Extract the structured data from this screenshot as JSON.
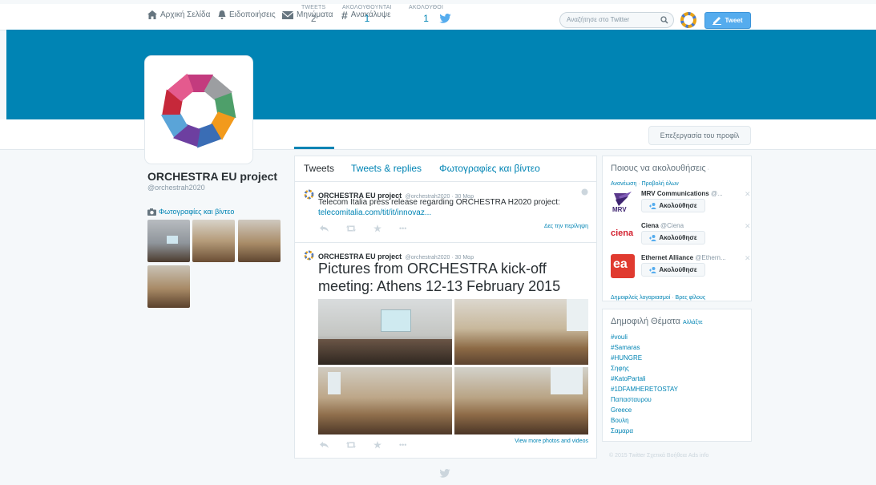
{
  "nav": {
    "home": "Αρχική Σελίδα",
    "notifications": "Ειδοποιήσεις",
    "messages": "Μηνύματα",
    "discover": "Ανακάλυψε",
    "search_placeholder": "Αναζήτησε στο Twitter",
    "tweet_button": "Tweet"
  },
  "profile": {
    "name": "ORCHESTRA EU project",
    "handle": "@orchestrah2020",
    "photos_link": "Φωτογραφίες και βίντεο",
    "edit_button": "Επεξεργασία του προφίλ",
    "stats": [
      {
        "label": "TWEETS",
        "value": "2"
      },
      {
        "label": "ΑΚΟΛΟΥΘΟΥΝΤΑΙ",
        "value": "1"
      },
      {
        "label": "ΑΚΟΛΟΥΘΟΙ",
        "value": "1"
      }
    ]
  },
  "timeline": {
    "tabs": [
      "Tweets",
      "Tweets & replies",
      "Φωτογραφίες και βίντεο"
    ],
    "tweets": [
      {
        "name": "ORCHESTRA EU project",
        "meta": "@orchestrah2020 · 30 Μαρ",
        "text": "Telecom Italia press release regarding ORCHESTRA H2020 project:",
        "link": "telecomitalia.com/tit/it/innovaz...",
        "action_link": "Δες την περίληψη"
      },
      {
        "name": "ORCHESTRA EU project",
        "meta": "@orchestrah2020 · 30 Μαρ",
        "text": "Pictures from ORCHESTRA kick-off meeting: Athens 12-13 February 2015",
        "action_link": "View more photos and videos"
      }
    ]
  },
  "who_to_follow": {
    "title": "Ποιους να ακολουθήσεις",
    "refresh": "Ανανέωση",
    "view_all": "Προβολή όλων",
    "follow_label": "Ακολούθησε",
    "accounts": [
      {
        "name": "MRV Communications",
        "handle": "@...",
        "logo_text": "MRV"
      },
      {
        "name": "Ciena",
        "handle": "@Ciena",
        "logo_text": "ciena"
      },
      {
        "name": "Ethernet Alliance",
        "handle": "@Ethern...",
        "logo_text": "ea"
      }
    ],
    "popular": "Δημοφιλείς λογαριασμοί",
    "find_friends": "Βρες φίλους"
  },
  "trends": {
    "title": "Δημοφιλή Θέματα",
    "change": "Αλλάξτε",
    "items": [
      "#vouli",
      "#Samaras",
      "#HUNGRE",
      "Σηφης",
      "#KatoPartali",
      "#1DFAMHERETOSTAY",
      "Παπασταυρου",
      "Greece",
      "Βουλη",
      "Σαμαρα"
    ]
  },
  "footer": "© 2015 Twitter   Σχετικά   Βοήθεια   Ads info",
  "colors": {
    "accent": "#0084b4",
    "tweet_button": "#55acee",
    "banner": "#0084b4"
  }
}
